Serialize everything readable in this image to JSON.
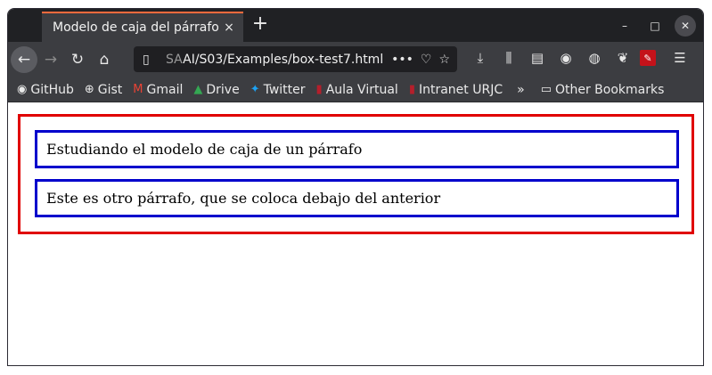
{
  "browser": {
    "tab_title": "Modelo de caja del párrafo",
    "tab_close": "×",
    "new_tab": "+",
    "url_prefix": "SA",
    "url_main": "AI/S03/Examples/box-test7.html",
    "url_more": "•••",
    "window_minimize": "–",
    "window_maximize": "□",
    "window_close": "✕"
  },
  "bookmarks": [
    {
      "label": "GitHub",
      "icon": "github-icon",
      "glyph": "◉"
    },
    {
      "label": "Gist",
      "icon": "globe-icon",
      "glyph": "⊕"
    },
    {
      "label": "Gmail",
      "icon": "gmail-icon",
      "glyph": "M"
    },
    {
      "label": "Drive",
      "icon": "drive-icon",
      "glyph": "▲"
    },
    {
      "label": "Twitter",
      "icon": "twitter-icon",
      "glyph": "✦"
    },
    {
      "label": "Aula Virtual",
      "icon": "urjc-icon",
      "glyph": "▮"
    },
    {
      "label": "Intranet URJC",
      "icon": "urjc-icon",
      "glyph": "▮"
    }
  ],
  "bookmarks_overflow": "»",
  "other_bookmarks": "Other Bookmarks",
  "page": {
    "paragraph1": "Estudiando el modelo de caja de un párrafo",
    "paragraph2": "Este es otro párrafo, que se coloca debajo del anterior"
  },
  "colors": {
    "outer_border": "#e00000",
    "paragraph_border": "#0000cc",
    "tab_accent": "#ff6a3d"
  }
}
